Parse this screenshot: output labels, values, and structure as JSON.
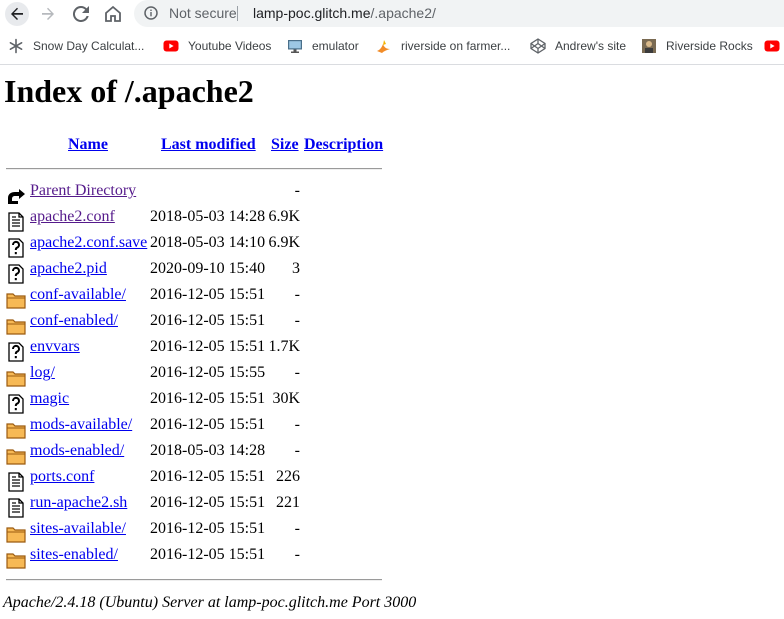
{
  "browser": {
    "not_secure_label": "Not secure",
    "url_host": "lamp-poc.glitch.me",
    "url_path": "/.apache2/"
  },
  "bookmarks": [
    {
      "label": "Snow Day Calculat...",
      "icon": "snowflake-icon"
    },
    {
      "label": "Youtube Videos",
      "icon": "youtube-icon"
    },
    {
      "label": "emulator",
      "icon": "monitor-icon"
    },
    {
      "label": "riverside on farmer...",
      "icon": "bird-icon"
    },
    {
      "label": "Andrew's site",
      "icon": "codepen-icon"
    },
    {
      "label": "Riverside Rocks",
      "icon": "avatar-icon"
    }
  ],
  "page": {
    "title": "Index of /.apache2",
    "columns": {
      "name": "Name",
      "last_modified": "Last modified",
      "size": "Size",
      "description": "Description"
    },
    "entries": [
      {
        "icon": "back-icon",
        "name": "Parent Directory",
        "modified": "",
        "size": "-",
        "visited": true
      },
      {
        "icon": "text-file-icon",
        "name": "apache2.conf",
        "modified": "2018-05-03 14:28",
        "size": "6.9K",
        "visited": true
      },
      {
        "icon": "unknown-file-icon",
        "name": "apache2.conf.save",
        "modified": "2018-05-03 14:10",
        "size": "6.9K",
        "visited": false
      },
      {
        "icon": "unknown-file-icon",
        "name": "apache2.pid",
        "modified": "2020-09-10 15:40",
        "size": "3",
        "visited": false
      },
      {
        "icon": "folder-icon",
        "name": "conf-available/",
        "modified": "2016-12-05 15:51",
        "size": "-",
        "visited": false
      },
      {
        "icon": "folder-icon",
        "name": "conf-enabled/",
        "modified": "2016-12-05 15:51",
        "size": "-",
        "visited": false
      },
      {
        "icon": "unknown-file-icon",
        "name": "envvars",
        "modified": "2016-12-05 15:51",
        "size": "1.7K",
        "visited": false
      },
      {
        "icon": "folder-icon",
        "name": "log/",
        "modified": "2016-12-05 15:55",
        "size": "-",
        "visited": false
      },
      {
        "icon": "unknown-file-icon",
        "name": "magic",
        "modified": "2016-12-05 15:51",
        "size": "30K",
        "visited": false
      },
      {
        "icon": "folder-icon",
        "name": "mods-available/",
        "modified": "2016-12-05 15:51",
        "size": "-",
        "visited": false
      },
      {
        "icon": "folder-icon",
        "name": "mods-enabled/",
        "modified": "2018-05-03 14:28",
        "size": "-",
        "visited": false
      },
      {
        "icon": "text-file-icon",
        "name": "ports.conf",
        "modified": "2016-12-05 15:51",
        "size": "226",
        "visited": false
      },
      {
        "icon": "text-file-icon",
        "name": "run-apache2.sh",
        "modified": "2016-12-05 15:51",
        "size": "221",
        "visited": false
      },
      {
        "icon": "folder-icon",
        "name": "sites-available/",
        "modified": "2016-12-05 15:51",
        "size": "-",
        "visited": false
      },
      {
        "icon": "folder-icon",
        "name": "sites-enabled/",
        "modified": "2016-12-05 15:51",
        "size": "-",
        "visited": false
      }
    ],
    "footer": "Apache/2.4.18 (Ubuntu) Server at lamp-poc.glitch.me Port 3000"
  }
}
